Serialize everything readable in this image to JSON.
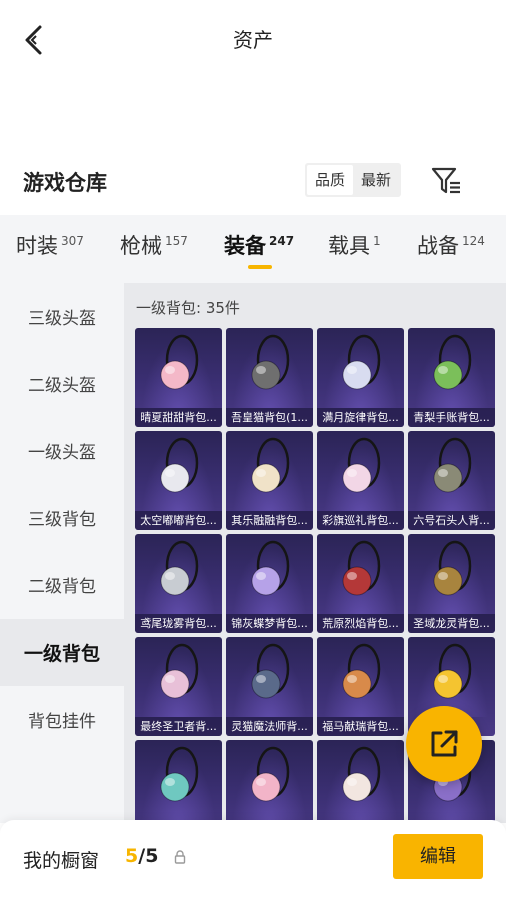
{
  "header": {
    "title": "资产"
  },
  "warehouse": {
    "title": "游戏仓库",
    "sort_options": [
      {
        "label": "品质",
        "active": true
      },
      {
        "label": "最新",
        "active": false
      }
    ]
  },
  "categories": [
    {
      "label": "时装",
      "count": "307",
      "active": false
    },
    {
      "label": "枪械",
      "count": "157",
      "active": false
    },
    {
      "label": "装备",
      "count": "247",
      "active": true
    },
    {
      "label": "载具",
      "count": "1",
      "active": false
    },
    {
      "label": "战备",
      "count": "124",
      "active": false
    }
  ],
  "subcategories": [
    {
      "label": "三级头盔",
      "active": false
    },
    {
      "label": "二级头盔",
      "active": false
    },
    {
      "label": "一级头盔",
      "active": false
    },
    {
      "label": "三级背包",
      "active": false
    },
    {
      "label": "二级背包",
      "active": false
    },
    {
      "label": "一级背包",
      "active": true
    },
    {
      "label": "背包挂件",
      "active": false
    }
  ],
  "content": {
    "section_title": "一级背包: 35件",
    "items": [
      {
        "name": "晴夏甜甜背包...",
        "icon": "pink-bunny-backpack",
        "color": "#f4b8c8"
      },
      {
        "name": "吾皇猫背包(1...",
        "icon": "cat-backpack",
        "color": "#6f6f6f"
      },
      {
        "name": "满月旋律背包...",
        "icon": "moon-backpack",
        "color": "#d8dcf0"
      },
      {
        "name": "青梨手账背包...",
        "icon": "pear-snail-backpack",
        "color": "#7bbf5a"
      },
      {
        "name": "太空嘟嘟背包...",
        "icon": "space-robot-backpack",
        "color": "#e8e8ee"
      },
      {
        "name": "其乐融融背包...",
        "icon": "cream-bunny-backpack",
        "color": "#f0e2c8"
      },
      {
        "name": "彩旗巡礼背包...",
        "icon": "flag-bunny-backpack",
        "color": "#f2d6e6"
      },
      {
        "name": "六号石头人背...",
        "icon": "stone-golem-backpack",
        "color": "#8a8a76"
      },
      {
        "name": "鸢尾珑雾背包...",
        "icon": "iris-pouch-backpack",
        "color": "#c8ccd2"
      },
      {
        "name": "锦灰蝶梦背包...",
        "icon": "butterfly-crystal-backpack",
        "color": "#b6a2e8"
      },
      {
        "name": "荒原烈焰背包...",
        "icon": "flame-mask-backpack",
        "color": "#b43838"
      },
      {
        "name": "圣域龙灵背包...",
        "icon": "dragon-shield-backpack",
        "color": "#a8843e"
      },
      {
        "name": "最终圣卫者背...",
        "icon": "guardian-wings-backpack",
        "color": "#e8c0d8"
      },
      {
        "name": "灵猫魔法师背...",
        "icon": "magic-orb-backpack",
        "color": "#5a6a8a"
      },
      {
        "name": "福马献瑞背包...",
        "icon": "horse-backpack",
        "color": "#d88a4a"
      },
      {
        "name": "",
        "icon": "pineapple-backpack",
        "color": "#f4c430"
      },
      {
        "name": "",
        "icon": "teal-pouch-backpack",
        "color": "#6fc8c0"
      },
      {
        "name": "",
        "icon": "pink-candy-backpack",
        "color": "#f2b4c8"
      },
      {
        "name": "",
        "icon": "bat-cat-backpack",
        "color": "#f2e6e0"
      },
      {
        "name": "",
        "icon": "purple-sack-backpack",
        "color": "#8a6fc8"
      }
    ]
  },
  "bottom_bar": {
    "label": "我的橱窗",
    "current": "5",
    "separator": "/",
    "max": "5",
    "edit_label": "编辑"
  }
}
